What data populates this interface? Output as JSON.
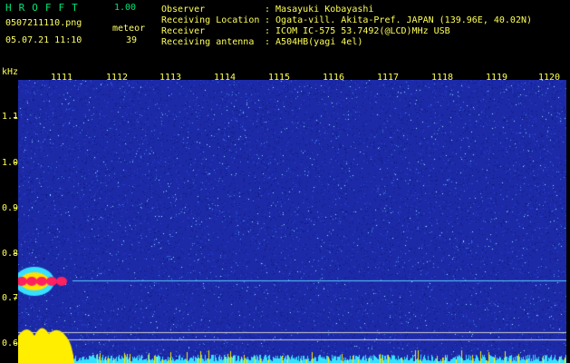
{
  "app": {
    "title": "HROFFT",
    "version": "1.00"
  },
  "file": {
    "name": "0507211110.png",
    "datetime": "05.07.21 11:10"
  },
  "meteor": {
    "label": "meteor",
    "count": "39"
  },
  "info": {
    "observer_label": "Observer",
    "observer_value": ": Masayuki Kobayashi",
    "location_label": "Receiving Location",
    "location_value": ": Ogata-vill. Akita-Pref. JAPAN (139.96E, 40.02N)",
    "receiver_label": "Receiver",
    "receiver_value": ": ICOM IC-575 53.7492(@LCD)MHz USB",
    "antenna_label": "Receiving antenna",
    "antenna_value": ": A504HB(yagi 4el)"
  },
  "axis": {
    "y_unit": "kHz",
    "y_ticks": [
      "1.1",
      "1.0",
      "0.9",
      "0.8",
      "0.7",
      "0.6"
    ],
    "x_ticks": [
      "1111",
      "1112",
      "1113",
      "1114",
      "1115",
      "1116",
      "1117",
      "1118",
      "1119",
      "1120"
    ]
  },
  "colors": {
    "background": "#000000",
    "label_yellow": "#ffff55",
    "title_green": "#00e676",
    "noise_blue": "#1c2aa8",
    "echo_red": "#ff2060",
    "echo_cyan": "#36e0ff",
    "level_yellow": "#ffee00"
  }
}
